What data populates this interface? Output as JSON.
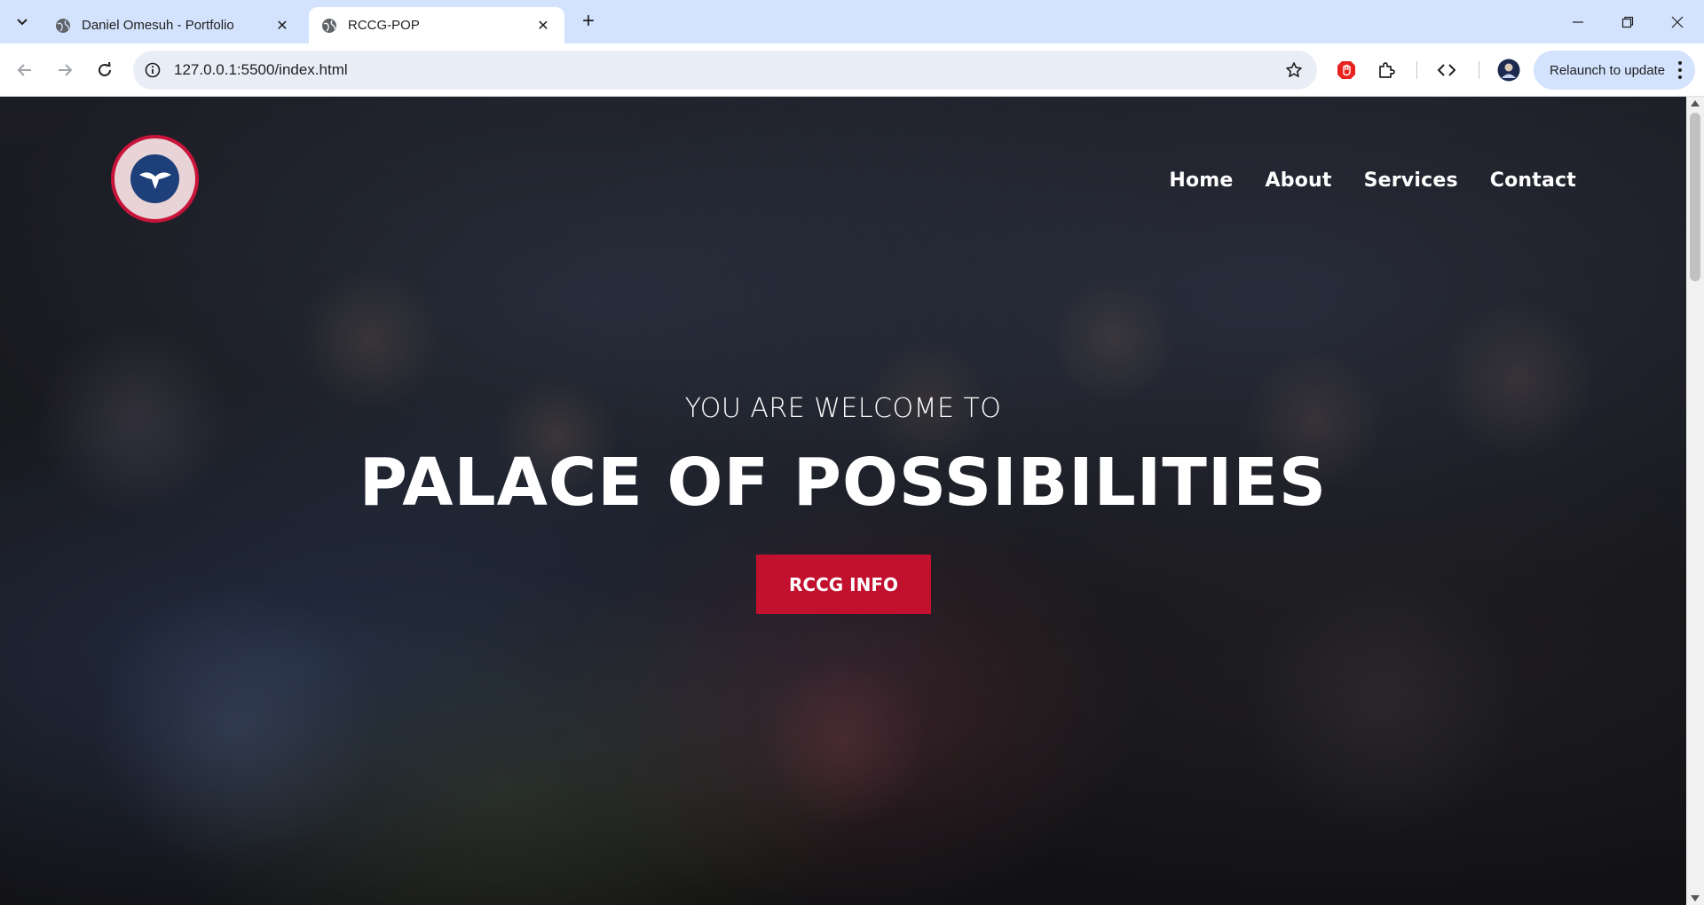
{
  "browser": {
    "tabs": [
      {
        "title": "Daniel Omesuh - Portfolio",
        "favicon": "globe-icon",
        "active": false
      },
      {
        "title": "RCCG-POP",
        "favicon": "globe-icon",
        "active": true
      }
    ],
    "url": "127.0.0.1:5500/index.html",
    "relaunch_label": "Relaunch to update"
  },
  "page": {
    "logo": {
      "alt": "THE REDEEMED CHRISTIAN CHURCH OF GOD",
      "colors": {
        "ring": "#c8143a",
        "center": "#1d3f7a"
      }
    },
    "nav": [
      "Home",
      "About",
      "Services",
      "Contact"
    ],
    "hero": {
      "subtitle": "YOU ARE WELCOME TO",
      "title": "PALACE OF POSSIBILITIES",
      "button_label": "RCCG INFO",
      "button_color": "#c2102f"
    }
  }
}
